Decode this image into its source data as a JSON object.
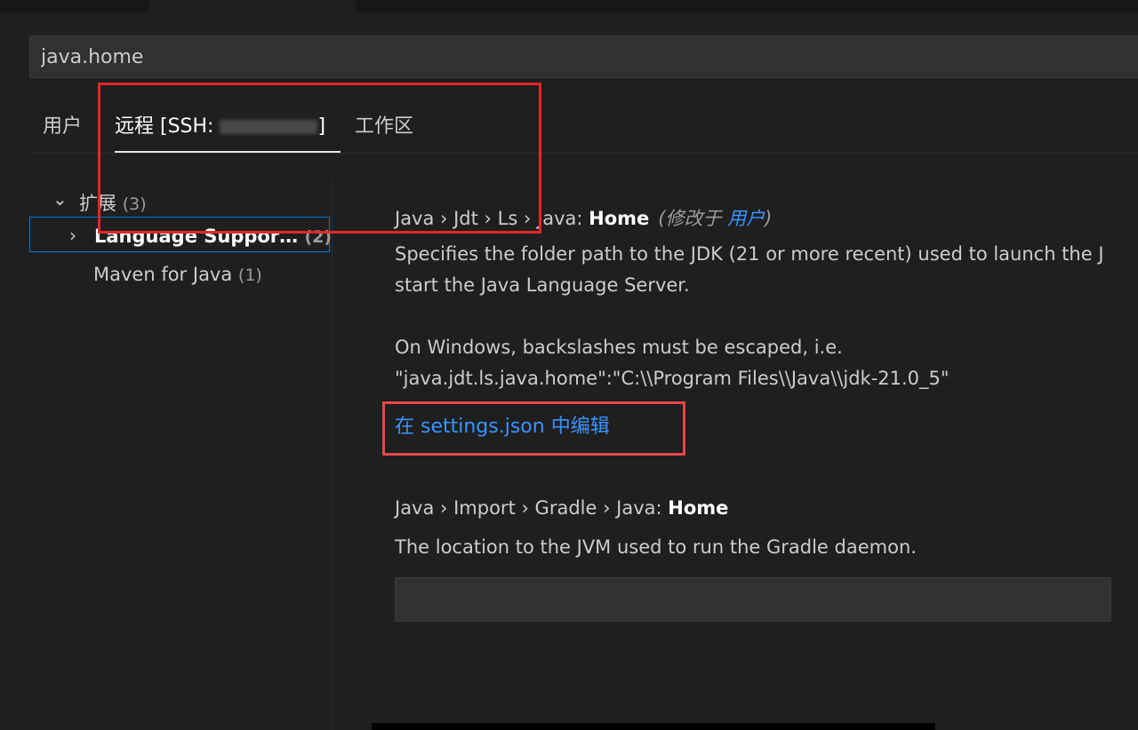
{
  "search": {
    "value": "java.home"
  },
  "tabs": [
    {
      "label": "用户",
      "active": false
    },
    {
      "label_prefix": "远程 [SSH: ",
      "label_suffix": "]",
      "active": true
    },
    {
      "label": "工作区",
      "active": false
    }
  ],
  "tree": {
    "extensions": {
      "label": "扩展",
      "count": "(3)"
    },
    "items": [
      {
        "label": "Language Suppor…",
        "count": "(2)",
        "selected": true
      },
      {
        "label": "Maven for Java",
        "count": "(1)",
        "selected": false
      }
    ]
  },
  "settings": [
    {
      "breadcrumb": "Java › Jdt › Ls › Java: ",
      "name": "Home",
      "modified_prefix": "(修改于 ",
      "modified_link": "用户",
      "modified_suffix": ")",
      "description_lines": [
        "Specifies the folder path to the JDK (21 or more recent) used to launch the J",
        "start the Java Language Server.",
        "",
        "On Windows, backslashes must be escaped, i.e.",
        "\"java.jdt.ls.java.home\":\"C:\\\\Program Files\\\\Java\\\\jdk-21.0_5\""
      ],
      "edit_link": "在 settings.json 中编辑"
    },
    {
      "breadcrumb": "Java › Import › Gradle › Java: ",
      "name": "Home",
      "description": "The location to the JVM used to run the Gradle daemon.",
      "input_value": ""
    }
  ],
  "colors": {
    "accent": "#0078d4",
    "link": "#3794ff",
    "annotation": "#e4262d"
  }
}
